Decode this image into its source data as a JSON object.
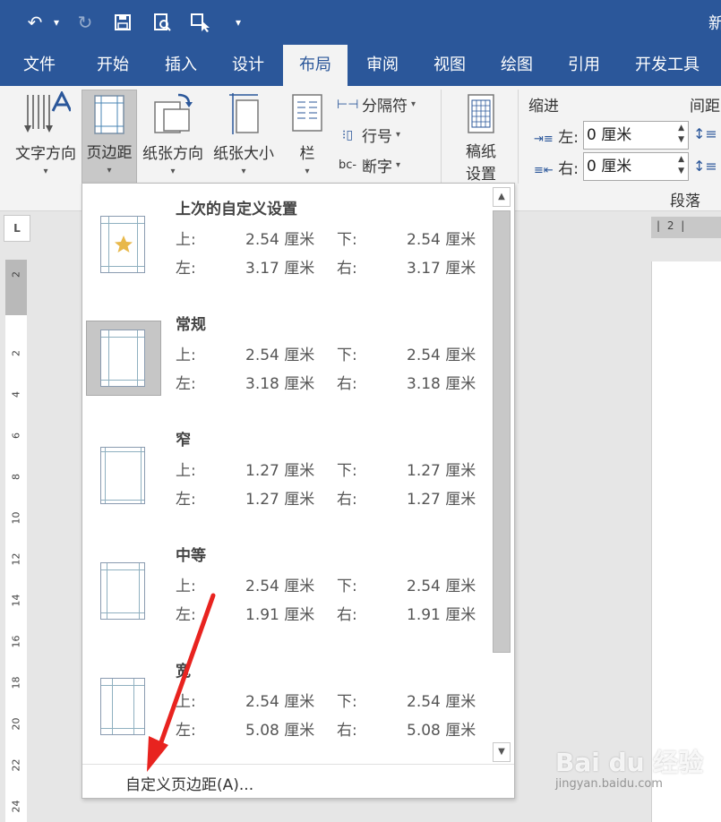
{
  "window": {
    "title_fragment": "新"
  },
  "quick_access": [
    {
      "name": "undo-icon",
      "glyph": "↶"
    },
    {
      "name": "undo-dropdown-icon",
      "glyph": "▾"
    },
    {
      "name": "redo-icon",
      "glyph": "↻"
    },
    {
      "name": "save-icon",
      "glyph": "🖫"
    },
    {
      "name": "print-preview-icon",
      "glyph": "⎙"
    },
    {
      "name": "touch-mode-icon",
      "glyph": "☐"
    },
    {
      "name": "customize-qat-icon",
      "glyph": "▾"
    }
  ],
  "tabs": [
    "文件",
    "开始",
    "插入",
    "设计",
    "布局",
    "审阅",
    "视图",
    "绘图",
    "引用",
    "开发工具"
  ],
  "active_tab": "布局",
  "ribbon": {
    "text_direction": "文字方向",
    "margins": "页边距",
    "orientation": "纸张方向",
    "size": "纸张大小",
    "columns": "栏",
    "breaks": "分隔符",
    "line_numbers": "行号",
    "hyphenation": "断字",
    "manuscript_line1": "稿纸",
    "manuscript_line2": "设置",
    "indent_header": "缩进",
    "spacing_header": "间距",
    "indent_left_label": "左:",
    "indent_right_label": "右:",
    "indent_left_value": "0 厘米",
    "indent_right_value": "0 厘米",
    "paragraph_group": "段落"
  },
  "ruler": {
    "h_label": "| 2 |",
    "v_numbers": [
      "2",
      "2",
      "4",
      "6",
      "8",
      "10",
      "12",
      "14",
      "16",
      "18",
      "20",
      "22",
      "24"
    ]
  },
  "margins_menu": {
    "items": [
      {
        "name": "上次的自定义设置",
        "top_label": "上:",
        "top": "2.54 厘米",
        "bottom_label": "下:",
        "bottom": "2.54 厘米",
        "left_label": "左:",
        "left": "3.17 厘米",
        "right_label": "右:",
        "right": "3.17 厘米"
      },
      {
        "name": "常规",
        "top_label": "上:",
        "top": "2.54 厘米",
        "bottom_label": "下:",
        "bottom": "2.54 厘米",
        "left_label": "左:",
        "left": "3.18 厘米",
        "right_label": "右:",
        "right": "3.18 厘米"
      },
      {
        "name": "窄",
        "top_label": "上:",
        "top": "1.27 厘米",
        "bottom_label": "下:",
        "bottom": "1.27 厘米",
        "left_label": "左:",
        "left": "1.27 厘米",
        "right_label": "右:",
        "right": "1.27 厘米"
      },
      {
        "name": "中等",
        "top_label": "上:",
        "top": "2.54 厘米",
        "bottom_label": "下:",
        "bottom": "2.54 厘米",
        "left_label": "左:",
        "left": "1.91 厘米",
        "right_label": "右:",
        "right": "1.91 厘米"
      },
      {
        "name": "宽",
        "top_label": "上:",
        "top": "2.54 厘米",
        "bottom_label": "下:",
        "bottom": "2.54 厘米",
        "left_label": "左:",
        "left": "5.08 厘米",
        "right_label": "右:",
        "right": "5.08 厘米"
      }
    ],
    "selected_item": "常规",
    "custom_label": "自定义页边距(A)..."
  },
  "colors": {
    "ribbon_blue": "#2b579a",
    "annotation_red": "#e8231f",
    "favorite_star": "#e8b84a"
  },
  "watermark": {
    "brand": "Bai du 经验",
    "url": "jingyan.baidu.com"
  }
}
